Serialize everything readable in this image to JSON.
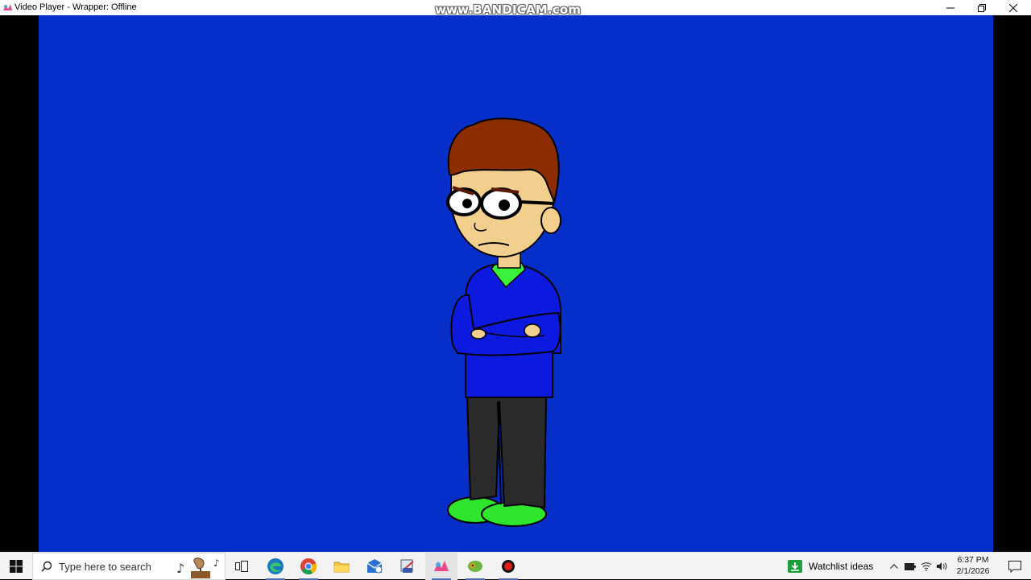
{
  "window": {
    "title": "Video Player - Wrapper: Offline",
    "watermark": "www.BANDICAM.com"
  },
  "colors": {
    "stage_background": "#052fc8",
    "titlebar": "#ffffff",
    "taskbar": "#f3f3f3"
  },
  "taskbar": {
    "search_placeholder": "Type here to search",
    "pinned_apps": [
      "task-view",
      "edge",
      "chrome",
      "file-explorer",
      "mail",
      "network-tool",
      "wrapper-offline",
      "app-green",
      "bandicam-record"
    ],
    "widget_label": "Watchlist ideas",
    "tray_icons": [
      "chevron-up",
      "battery",
      "wifi",
      "volume"
    ],
    "clock": {
      "time": "6:37 PM",
      "date": "2/1/2026"
    }
  }
}
